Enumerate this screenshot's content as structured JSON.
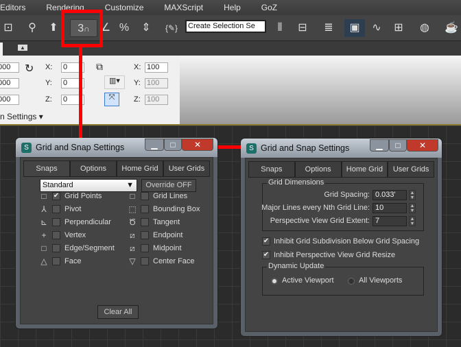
{
  "menu": [
    "Editors",
    "Rendering",
    "Customize",
    "MAXScript",
    "Help",
    "GoZ"
  ],
  "toolbar": {
    "selection_set_placeholder": "Create Selection Se",
    "snap_button_label": "3",
    "icons": [
      "select-link-icon",
      "hierarchy-icon",
      "bind-icon",
      "snap-3d-icon",
      "angle-snap-icon",
      "percent-snap-icon",
      "spinner-snap-icon",
      "named-selection-edit-icon",
      "mirror-icon",
      "align-icon",
      "layer-icon",
      "scene-explorer-icon",
      "curve-editor-icon",
      "schematic-icon",
      "material-editor-icon",
      "render-setup-icon"
    ]
  },
  "ribbon": {
    "left_values": [
      "000",
      "000",
      "000"
    ],
    "rot": {
      "x_label": "X:",
      "y_label": "Y:",
      "z_label": "Z:",
      "x": "0",
      "y": "0",
      "z": "0"
    },
    "scale": {
      "x_label": "X:",
      "y_label": "Y:",
      "z_label": "Z:",
      "x": "100",
      "y": "100",
      "z": "100"
    },
    "footer": "n Settings"
  },
  "dialog1": {
    "title": "Grid and Snap Settings",
    "tabs": [
      "Snaps",
      "Options",
      "Home Grid",
      "User Grids"
    ],
    "active_tab": "Snaps",
    "dropdown": "Standard",
    "override": "Override OFF",
    "snaps_left": [
      {
        "label": "Grid Points",
        "checked": true,
        "icon": "square-icon"
      },
      {
        "label": "Pivot",
        "checked": false,
        "icon": "pivot-icon"
      },
      {
        "label": "Perpendicular",
        "checked": false,
        "icon": "perpendicular-icon"
      },
      {
        "label": "Vertex",
        "checked": false,
        "icon": "plus-icon"
      },
      {
        "label": "Edge/Segment",
        "checked": false,
        "icon": "square-icon"
      },
      {
        "label": "Face",
        "checked": false,
        "icon": "triangle-icon"
      }
    ],
    "snaps_right": [
      {
        "label": "Grid Lines",
        "checked": false,
        "icon": "square-icon"
      },
      {
        "label": "Bounding Box",
        "checked": false,
        "icon": "dashed-box-icon"
      },
      {
        "label": "Tangent",
        "checked": false,
        "icon": "tangent-icon"
      },
      {
        "label": "Endpoint",
        "checked": false,
        "icon": "endpoint-icon"
      },
      {
        "label": "Midpoint",
        "checked": false,
        "icon": "midpoint-icon"
      },
      {
        "label": "Center Face",
        "checked": false,
        "icon": "inverted-triangle-icon"
      }
    ],
    "clear_all": "Clear All"
  },
  "dialog2": {
    "title": "Grid and Snap Settings",
    "tabs": [
      "Snaps",
      "Options",
      "Home Grid",
      "User Grids"
    ],
    "active_tab": "Home Grid",
    "grid_dimensions": "Grid Dimensions",
    "grid_spacing_label": "Grid Spacing:",
    "grid_spacing": "0.033'",
    "major_lines_label": "Major Lines every Nth Grid Line:",
    "major_lines": "10",
    "extent_label": "Perspective View Grid Extent:",
    "extent": "7",
    "inhibit_subdivision": "Inhibit Grid Subdivision Below Grid Spacing",
    "inhibit_subdivision_checked": true,
    "inhibit_resize": "Inhibit Perspective View Grid Resize",
    "inhibit_resize_checked": true,
    "dynamic_update": "Dynamic Update",
    "active_viewport": "Active Viewport",
    "all_viewports": "All Viewports",
    "selected": "Active Viewport"
  },
  "highlight_color": "#ff0000"
}
